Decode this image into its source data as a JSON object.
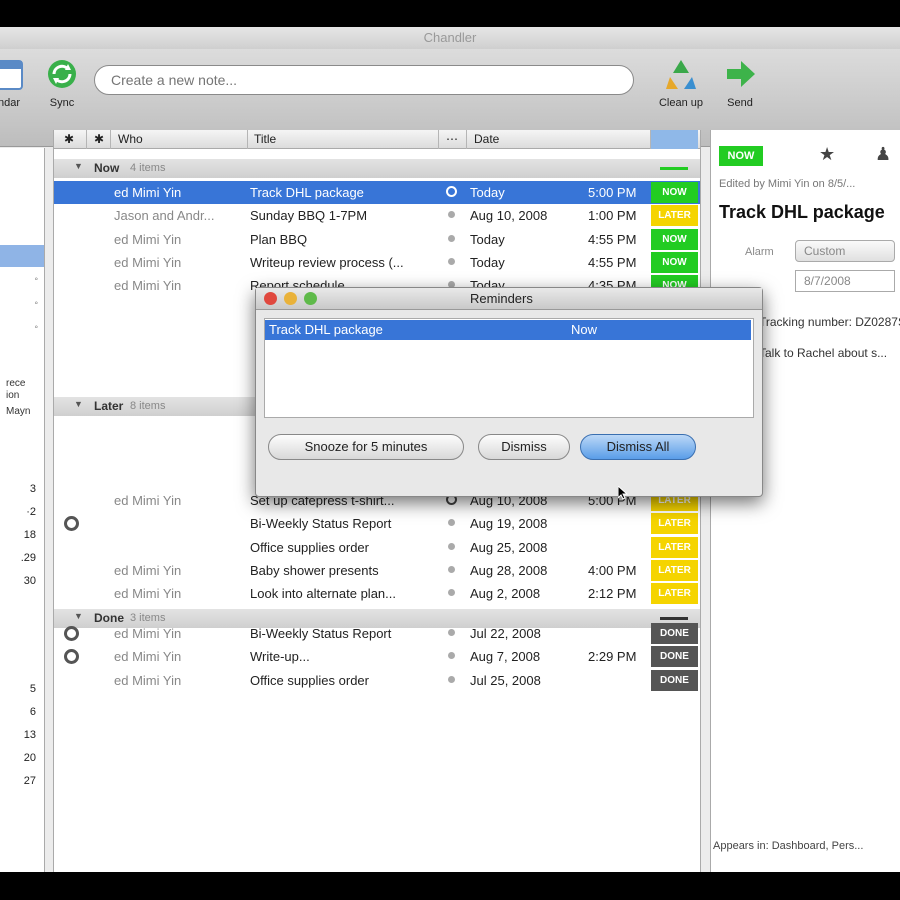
{
  "app": {
    "title": "Chandler"
  },
  "toolbar": {
    "calendar_label": "ndar",
    "sync_label": "Sync",
    "note_placeholder": "Create a new note...",
    "cleanup_label": "Clean up",
    "send_label": "Send"
  },
  "table": {
    "columns": [
      "Who",
      "Title",
      "Date"
    ],
    "groups": {
      "now": {
        "name": "Now",
        "count": "4 items"
      },
      "later": {
        "name": "Later",
        "count": "8 items"
      },
      "done": {
        "name": "Done",
        "count": "3 items"
      }
    },
    "now_rows": [
      {
        "who": "ed Mimi Yin",
        "title": "Track DHL package",
        "date": "Today",
        "time": "5:00 PM",
        "status": "NOW"
      },
      {
        "who": "Jason and Andr...",
        "title": "Sunday BBQ 1-7PM",
        "date": "Aug 10, 2008",
        "time": "1:00 PM",
        "status": "LATER"
      },
      {
        "who": "ed Mimi Yin",
        "title": "Plan BBQ",
        "date": "Today",
        "time": "4:55 PM",
        "status": "NOW"
      },
      {
        "who": "ed Mimi Yin",
        "title": "Writeup review process (...",
        "date": "Today",
        "time": "4:55 PM",
        "status": "NOW"
      },
      {
        "who": "ed Mimi Yin",
        "title": "Report schedule",
        "date": "Today",
        "time": "4:35 PM",
        "status": "NOW"
      }
    ],
    "later_rows": [
      {
        "who": "ed Mimi Yin",
        "title": "Set up cafepress t-shirt...",
        "date": "Aug 10, 2008",
        "time": "5:00 PM",
        "status": "LATER"
      },
      {
        "who": "",
        "title": "Bi-Weekly Status Report",
        "date": "Aug 19, 2008",
        "time": "",
        "status": "LATER"
      },
      {
        "who": "",
        "title": "Office supplies order",
        "date": "Aug 25, 2008",
        "time": "",
        "status": "LATER"
      },
      {
        "who": "ed Mimi Yin",
        "title": "Baby shower presents",
        "date": "Aug 28, 2008",
        "time": "4:00 PM",
        "status": "LATER"
      },
      {
        "who": "ed Mimi Yin",
        "title": "Look into alternate plan...",
        "date": "Aug 2, 2008",
        "time": "2:12 PM",
        "status": "LATER"
      }
    ],
    "done_rows": [
      {
        "who": "ed Mimi Yin",
        "title": "Bi-Weekly Status Report",
        "date": "Jul 22, 2008",
        "time": "",
        "status": "DONE"
      },
      {
        "who": "ed Mimi Yin",
        "title": "Write-up...",
        "date": "Aug 7, 2008",
        "time": "2:29 PM",
        "status": "DONE"
      },
      {
        "who": "ed Mimi Yin",
        "title": "Office supplies order",
        "date": "Jul 25, 2008",
        "time": "",
        "status": "DONE"
      }
    ]
  },
  "detail": {
    "status": "NOW",
    "edited_by": "Edited by Mimi Yin on 8/5/...",
    "title": "Track DHL package",
    "alarm_label": "Alarm",
    "alarm_value": "Custom",
    "date_value": "8/7/2008",
    "body_line1": "Tracking number: DZ0287S...",
    "body_line2": "Talk to Rachel about s...",
    "appears_in": "Appears in: Dashboard, Pers..."
  },
  "sidebar": {
    "text1": "rece",
    "text2": "ion",
    "text3": "Mayn"
  },
  "dialog": {
    "title": "Reminders",
    "item_title": "Track DHL package",
    "item_when": "Now",
    "snooze_label": "Snooze for 5 minutes",
    "dismiss_label": "Dismiss",
    "dismiss_all_label": "Dismiss All"
  },
  "colors": {
    "now": "#22cc22",
    "later": "#f5d400",
    "done": "#555555",
    "selection": "#3875d7"
  }
}
